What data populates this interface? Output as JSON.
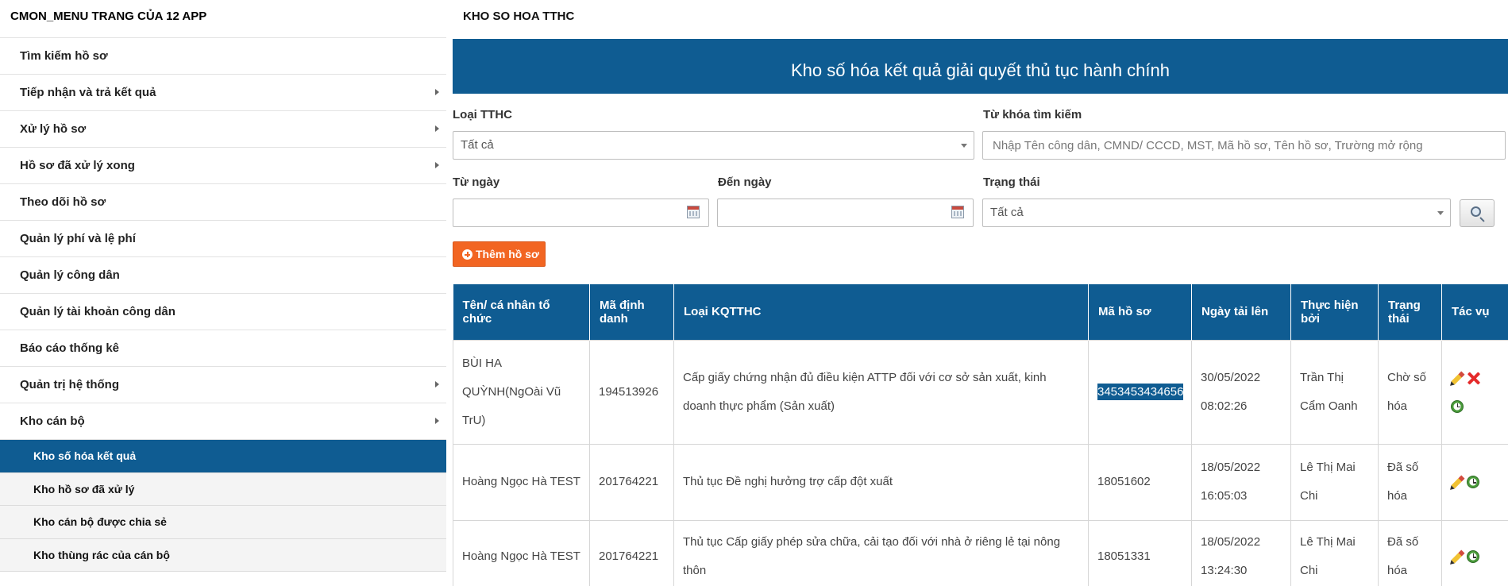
{
  "sidebar": {
    "title": "CMON_MENU TRANG CỦA 12 APP",
    "items": [
      {
        "label": "Tìm kiếm hồ sơ",
        "has_submenu": false
      },
      {
        "label": "Tiếp nhận và trả kết quả",
        "has_submenu": true
      },
      {
        "label": "Xử lý hồ sơ",
        "has_submenu": true
      },
      {
        "label": "Hồ sơ đã xử lý xong",
        "has_submenu": true
      },
      {
        "label": "Theo dõi hồ sơ",
        "has_submenu": false
      },
      {
        "label": "Quản lý phí và lệ phí",
        "has_submenu": false
      },
      {
        "label": "Quản lý công dân",
        "has_submenu": false
      },
      {
        "label": "Quản lý tài khoản công dân",
        "has_submenu": false
      },
      {
        "label": "Báo cáo thống kê",
        "has_submenu": false
      },
      {
        "label": "Quản trị hệ thống",
        "has_submenu": true
      },
      {
        "label": "Kho cán bộ",
        "has_submenu": true
      }
    ],
    "subitems": [
      {
        "label": "Kho số hóa kết quả",
        "active": true
      },
      {
        "label": "Kho hồ sơ đã xử lý",
        "active": false
      },
      {
        "label": "Kho cán bộ được chia sẻ",
        "active": false
      },
      {
        "label": "Kho thùng rác của cán bộ",
        "active": false
      }
    ]
  },
  "header": {
    "breadcrumb": "KHO SO HOA TTHC",
    "banner_title": "Kho số hóa kết quả giải quyết thủ tục hành chính"
  },
  "filters": {
    "loai_tthc_label": "Loại TTHC",
    "loai_tthc_value": "Tất cả",
    "keyword_label": "Từ khóa tìm kiếm",
    "keyword_placeholder": "Nhập Tên công dân, CMND/ CCCD, MST, Mã hồ sơ, Tên hồ sơ, Trường mở rộng",
    "keyword_value": "",
    "from_date_label": "Từ ngày",
    "from_date_value": "",
    "to_date_label": "Đến ngày",
    "to_date_value": "",
    "status_label": "Trạng thái",
    "status_value": "Tất cả"
  },
  "actions": {
    "add_label": "Thêm hồ sơ"
  },
  "table": {
    "headers": [
      "Tên/ cá nhân tổ chức",
      "Mã định danh",
      "Loại KQTTHC",
      "Mã hồ sơ",
      "Ngày tải lên",
      "Thực hiện bởi",
      "Trạng thái",
      "Tác vụ"
    ],
    "rows": [
      {
        "name": "BÙI HA QUỲNH(NgOài Vũ TrU)",
        "id": "194513926",
        "type": "Cấp giấy chứng nhận đủ điều kiện ATTP đối với cơ sở sản xuất, kinh doanh thực phẩm (Sản xuất)",
        "code": "3453453434656",
        "date": "30/05/2022",
        "time": "08:02:26",
        "by": "Trần Thị Cẩm Oanh",
        "status": "Chờ số hóa",
        "actions": [
          "edit-icon",
          "delete-icon",
          "history-icon"
        ]
      },
      {
        "name": "Hoàng Ngọc Hà TEST",
        "id": "201764221",
        "type": "Thủ tục Đề nghị hưởng trợ cấp đột xuất",
        "code": "18051602",
        "date": "18/05/2022",
        "time": "16:05:03",
        "by": "Lê Thị Mai Chi",
        "status": "Đã số hóa",
        "actions": [
          "edit-icon",
          "history-icon"
        ]
      },
      {
        "name": "Hoàng Ngọc Hà TEST",
        "id": "201764221",
        "type": "Thủ tục Cấp giấy phép sửa chữa, cải tạo đối với nhà ở riêng lẻ tại nông thôn",
        "code": "18051331",
        "date": "18/05/2022",
        "time": "13:24:30",
        "by": "Lê Thị Mai Chi",
        "status": "Đã số hóa",
        "actions": [
          "edit-icon",
          "history-icon"
        ]
      }
    ]
  },
  "colors": {
    "primary": "#0f5c92",
    "accent_button": "#f26522"
  }
}
